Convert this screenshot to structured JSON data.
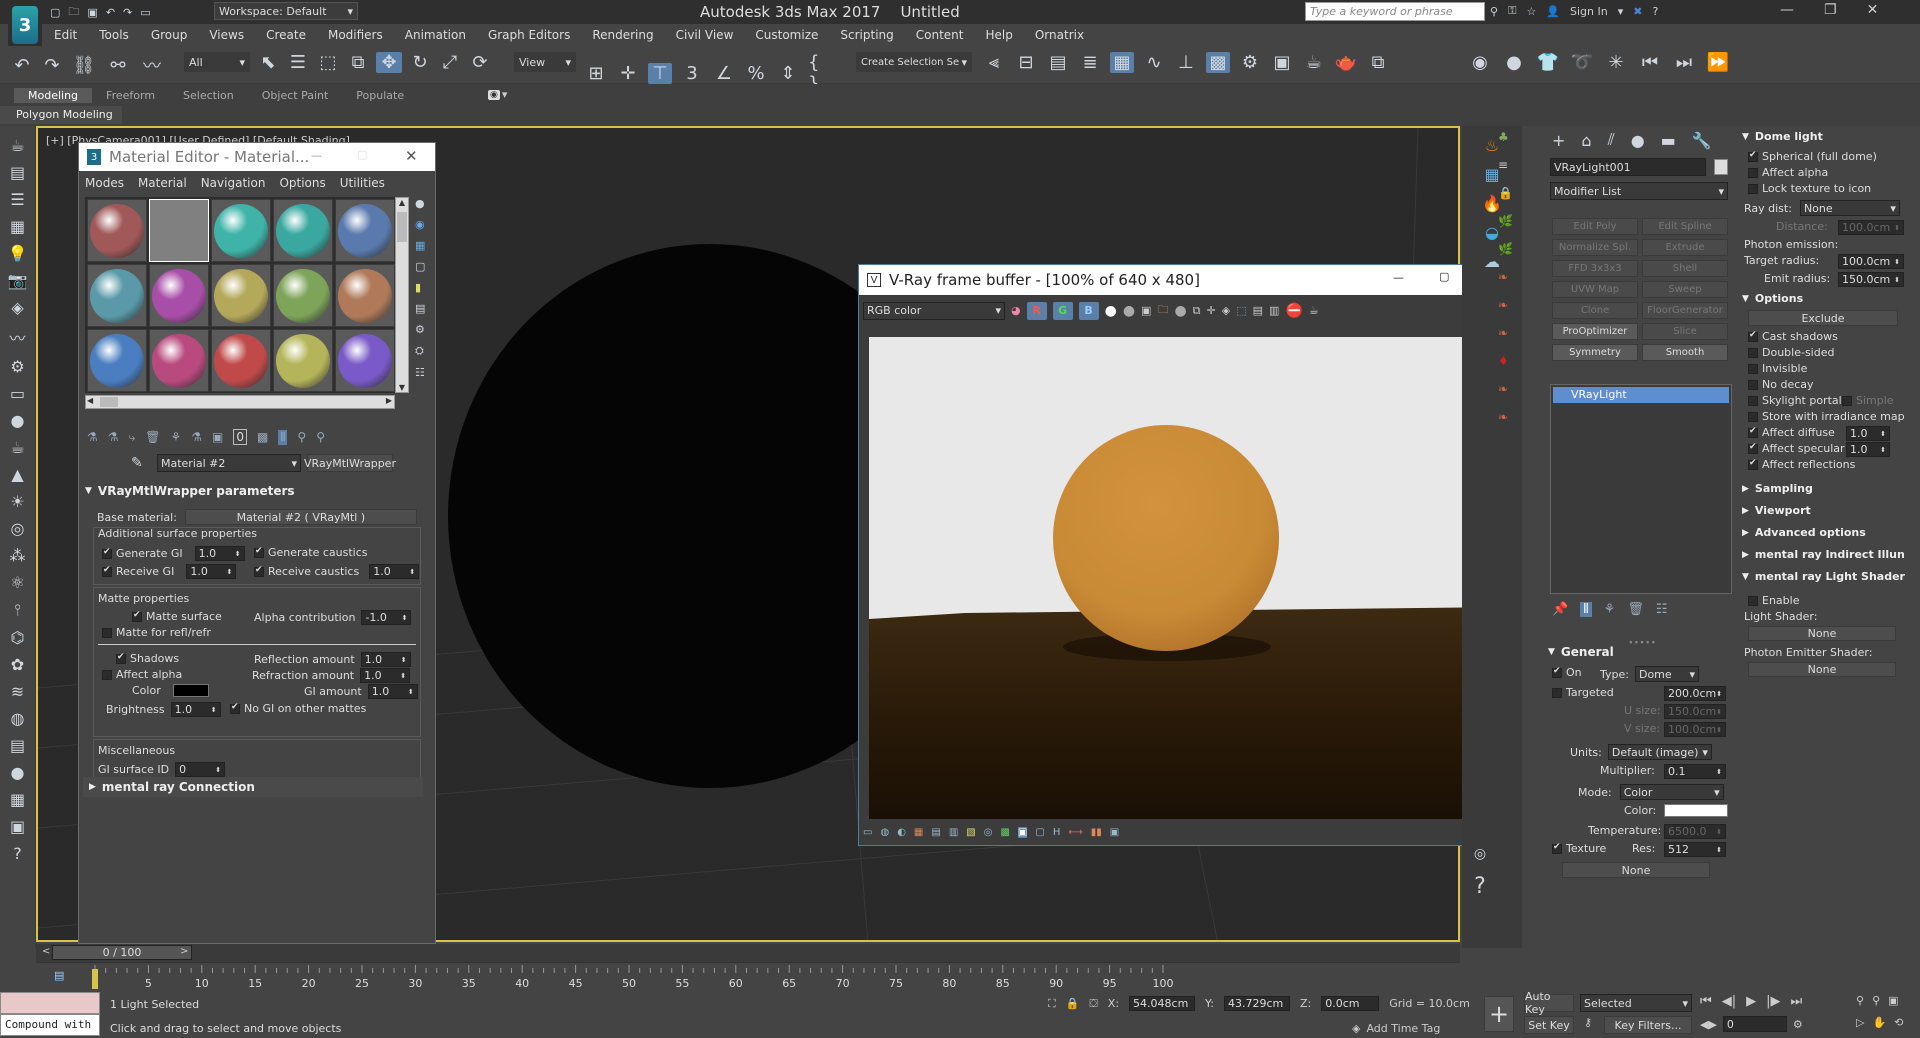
{
  "app": {
    "title": "Autodesk 3ds Max 2017",
    "doc": "Untitled",
    "workspace": "Workspace: Default",
    "search_placeholder": "Type a keyword or phrase",
    "sign_in": "Sign In"
  },
  "menu": [
    "Edit",
    "Tools",
    "Group",
    "Views",
    "Create",
    "Modifiers",
    "Animation",
    "Graph Editors",
    "Rendering",
    "Civil View",
    "Customize",
    "Scripting",
    "Content",
    "Help",
    "Ornatrix"
  ],
  "toolbar": {
    "filter": "All",
    "refcoord": "View",
    "selset": "Create Selection Se"
  },
  "ribbon": {
    "tabs": [
      "Modeling",
      "Freeform",
      "Selection",
      "Object Paint",
      "Populate"
    ],
    "sub": "Polygon Modeling"
  },
  "viewport": {
    "label": "[+] [PhysCamera001] [User Defined] [Default Shading]"
  },
  "mated": {
    "title": "Material Editor - Material...",
    "menus": [
      "Modes",
      "Material",
      "Navigation",
      "Options",
      "Utilities"
    ],
    "spheres": [
      "#a05858",
      "#808080",
      "#3fb3a8",
      "#3aa8a0",
      "#5a7aad",
      "#5a9aa8",
      "#a84ea8",
      "#b4a85a",
      "#7ea45a",
      "#b07a5a",
      "#4a7ec0",
      "#b84a7e",
      "#c04a4a",
      "#b4b45a",
      "#7a5ac8"
    ],
    "matname": "Material #2",
    "mattype": "VRayMtlWrapper",
    "rollout": "VRayMtlWrapper parameters",
    "base_label": "Base material:",
    "base_value": "Material #2  ( VRayMtl )",
    "add_group": "Additional surface properties",
    "gen_gi": "Generate GI",
    "gen_gi_val": "1.0",
    "gen_caus": "Generate caustics",
    "rec_gi": "Receive GI",
    "rec_gi_val": "1.0",
    "rec_caus": "Receive caustics",
    "rec_caus_val": "1.0",
    "matte_group": "Matte properties",
    "matte_surface": "Matte surface",
    "alpha_contrib": "Alpha contribution",
    "alpha_val": "-1.0",
    "matte_refl": "Matte for refl/refr",
    "shadows": "Shadows",
    "refl_amt": "Reflection amount",
    "refl_val": "1.0",
    "affect_alpha": "Affect alpha",
    "refr_amt": "Refraction amount",
    "refr_val": "1.0",
    "color": "Color",
    "gi_amt": "GI amount",
    "gi_val": "1.0",
    "brightness": "Brightness",
    "bright_val": "1.0",
    "no_gi": "No GI on other mattes",
    "misc": "Miscellaneous",
    "gi_surface": "GI surface ID",
    "gi_surface_val": "0",
    "mr": "mental ray Connection"
  },
  "vfb": {
    "title": "V-Ray frame buffer - [100% of 640 x 480]",
    "channel": "RGB color"
  },
  "cmd": {
    "objname": "VRayLight001",
    "modlist": "Modifier List",
    "mods": [
      "Edit Poly",
      "Edit Spline",
      "Normalize Spl.",
      "Extrude",
      "FFD 3x3x3",
      "Shell",
      "UVW Map",
      "Sweep",
      "Clone",
      "FloorGenerator",
      "ProOptimizer",
      "Slice",
      "Symmetry",
      "Smooth"
    ],
    "stack_item": "VRayLight",
    "general": "General",
    "on": "On",
    "type_label": "Type:",
    "type_val": "Dome",
    "targeted": "Targeted",
    "targeted_val": "200.0cm",
    "usize": "U size:",
    "usize_val": "150.0cm",
    "vsize": "V size:",
    "vsize_val": "100.0cm",
    "units": "Units:",
    "units_val": "Default (image)",
    "mult": "Multiplier:",
    "mult_val": "0.1",
    "mode": "Mode:",
    "mode_val": "Color",
    "color": "Color:",
    "temp": "Temperature:",
    "temp_val": "6500.0",
    "texture": "Texture",
    "res": "Res:",
    "res_val": "512",
    "none": "None"
  },
  "right": {
    "dome": "Dome light",
    "spherical": "Spherical (full dome)",
    "affect_alpha": "Affect alpha",
    "lock_tex": "Lock texture to icon",
    "raydist": "Ray dist:",
    "raydist_val": "None",
    "distance": "Distance:",
    "distance_val": "100.0cm",
    "photon": "Photon emission:",
    "target_r": "Target radius:",
    "target_r_val": "100.0cm",
    "emit_r": "Emit radius:",
    "emit_r_val": "150.0cm",
    "options": "Options",
    "exclude": "Exclude",
    "cast": "Cast shadows",
    "double": "Double-sided",
    "invisible": "Invisible",
    "nodecay": "No decay",
    "skylight": "Skylight portal",
    "simple": "Simple",
    "store": "Store with irradiance map",
    "aff_diff": "Affect diffuse",
    "aff_diff_val": "1.0",
    "aff_spec": "Affect specular",
    "aff_spec_val": "1.0",
    "aff_refl": "Affect reflections",
    "sampling": "Sampling",
    "viewport": "Viewport",
    "adv": "Advanced options",
    "mr_ind": "mental ray Indirect Illun",
    "mr_shader": "mental ray Light Shader",
    "enable": "Enable",
    "light_shader": "Light Shader:",
    "none": "None",
    "photon_shader": "Photon Emitter Shader:"
  },
  "timeline": {
    "frame": "0 / 100",
    "ticks": [
      "0",
      "5",
      "10",
      "15",
      "20",
      "25",
      "30",
      "35",
      "40",
      "45",
      "50",
      "55",
      "60",
      "65",
      "70",
      "75",
      "80",
      "85",
      "90",
      "95",
      "100"
    ]
  },
  "status": {
    "script": "Compound with",
    "selected": "1 Light Selected",
    "prompt": "Click and drag to select and move objects",
    "x": "54.048cm",
    "y": "43.729cm",
    "z": "0.0cm",
    "grid": "Grid = 10.0cm",
    "autokey": "Auto Key",
    "setkey": "Set Key",
    "selmode": "Selected",
    "keyfilters": "Key Filters...",
    "frame": "0",
    "addtime": "Add Time Tag"
  }
}
